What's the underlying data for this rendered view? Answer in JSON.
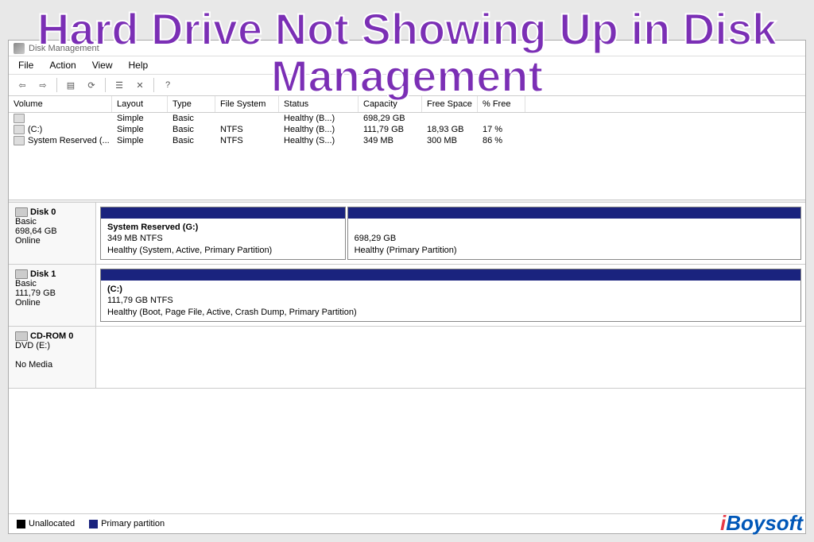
{
  "overlay": {
    "title": "Hard Drive Not Showing Up in Disk Management"
  },
  "window": {
    "title": "Disk Management"
  },
  "menu": {
    "file": "File",
    "action": "Action",
    "view": "View",
    "help": "Help"
  },
  "toolbar": {
    "back": "⇦",
    "forward": "⇨",
    "up": "▤",
    "refresh": "⟳",
    "props": "☰",
    "delete": "✕",
    "help": "?"
  },
  "columns": {
    "volume": "Volume",
    "layout": "Layout",
    "type": "Type",
    "filesystem": "File System",
    "status": "Status",
    "capacity": "Capacity",
    "free": "Free Space",
    "pctfree": "% Free"
  },
  "volumes": [
    {
      "name": "",
      "layout": "Simple",
      "type": "Basic",
      "fs": "",
      "status": "Healthy (B...)",
      "cap": "698,29 GB",
      "free": "",
      "pct": ""
    },
    {
      "name": "(C:)",
      "layout": "Simple",
      "type": "Basic",
      "fs": "NTFS",
      "status": "Healthy (B...)",
      "cap": "111,79 GB",
      "free": "18,93 GB",
      "pct": "17 %"
    },
    {
      "name": "System Reserved (...",
      "layout": "Simple",
      "type": "Basic",
      "fs": "NTFS",
      "status": "Healthy (S...)",
      "cap": "349 MB",
      "free": "300 MB",
      "pct": "86 %"
    }
  ],
  "disks": [
    {
      "label": "Disk 0",
      "type": "Basic",
      "size": "698,64 GB",
      "status": "Online",
      "parts": [
        {
          "title": "System Reserved  (G:)",
          "line2": "349 MB NTFS",
          "line3": "Healthy (System, Active, Primary Partition)",
          "flex": "35"
        },
        {
          "title": "",
          "line2": "698,29 GB",
          "line3": "Healthy (Primary Partition)",
          "flex": "65"
        }
      ]
    },
    {
      "label": "Disk 1",
      "type": "Basic",
      "size": "111,79 GB",
      "status": "Online",
      "parts": [
        {
          "title": "  (C:)",
          "line2": "111,79 GB NTFS",
          "line3": "Healthy (Boot, Page File, Active, Crash Dump, Primary Partition)",
          "flex": "100"
        }
      ]
    },
    {
      "label": "CD-ROM 0",
      "type": "DVD (E:)",
      "size": "",
      "status": "No Media",
      "parts": []
    }
  ],
  "legend": {
    "unallocated": "Unallocated",
    "primary": "Primary partition"
  },
  "brand": {
    "text": "iBoysoft"
  }
}
